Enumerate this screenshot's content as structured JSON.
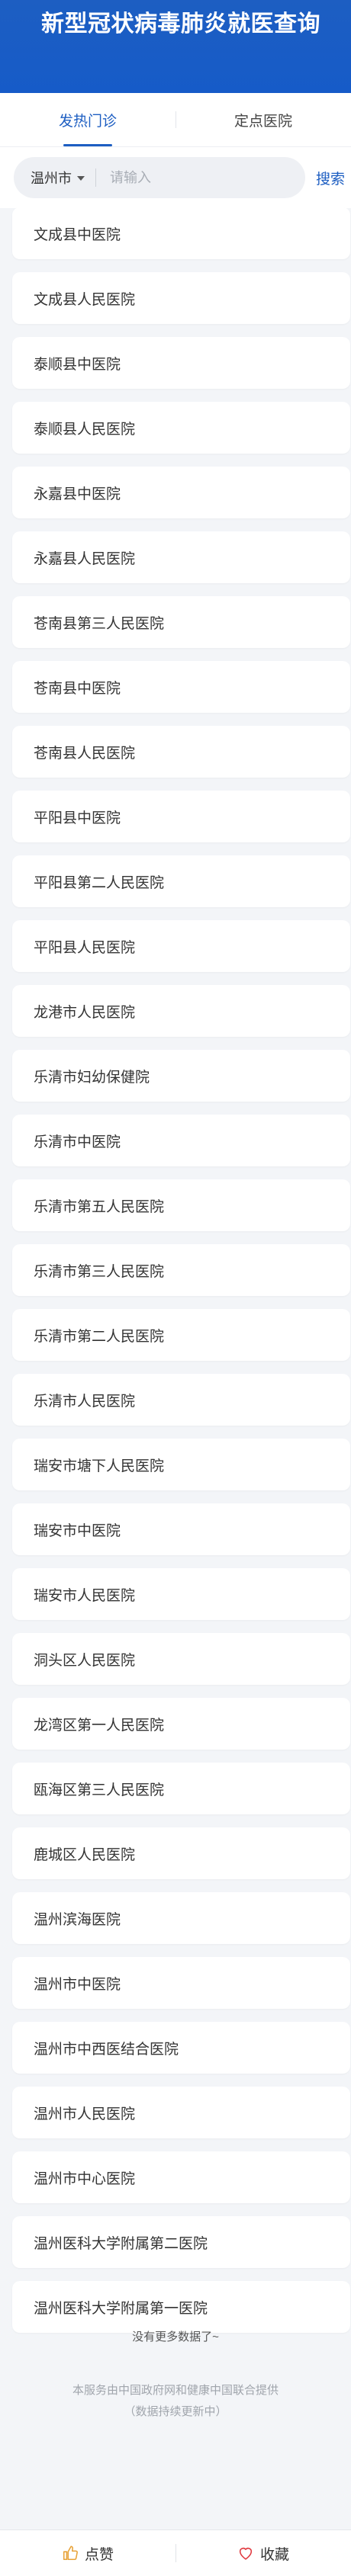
{
  "header": {
    "title": "新型冠状病毒肺炎就医查询"
  },
  "tabs": [
    {
      "label": "发热门诊",
      "active": true
    },
    {
      "label": "定点医院",
      "active": false
    }
  ],
  "search": {
    "city": "温州市",
    "placeholder": "请输入",
    "value": "",
    "button_label": "搜索"
  },
  "hospitals": [
    "文成县中医院",
    "文成县人民医院",
    "泰顺县中医院",
    "泰顺县人民医院",
    "永嘉县中医院",
    "永嘉县人民医院",
    "苍南县第三人民医院",
    "苍南县中医院",
    "苍南县人民医院",
    "平阳县中医院",
    "平阳县第二人民医院",
    "平阳县人民医院",
    "龙港市人民医院",
    "乐清市妇幼保健院",
    "乐清市中医院",
    "乐清市第五人民医院",
    "乐清市第三人民医院",
    "乐清市第二人民医院",
    "乐清市人民医院",
    "瑞安市塘下人民医院",
    "瑞安市中医院",
    "瑞安市人民医院",
    "洞头区人民医院",
    "龙湾区第一人民医院",
    "瓯海区第三人民医院",
    "鹿城区人民医院",
    "温州滨海医院",
    "温州市中医院",
    "温州市中西医结合医院",
    "温州市人民医院",
    "温州市中心医院",
    "温州医科大学附属第二医院",
    "温州医科大学附属第一医院"
  ],
  "no_more_text": "没有更多数据了~",
  "footer": {
    "line1": "本服务由中国政府网和健康中国联合提供",
    "line2": "（数据持续更新中）"
  },
  "bottom_bar": {
    "like_label": "点赞",
    "favorite_label": "收藏"
  },
  "colors": {
    "brand": "#1d5ec2",
    "background": "#f3f5f8",
    "like_icon": "#e8a33a",
    "favorite_icon": "#e0383e"
  },
  "icons": {
    "city_dropdown": "caret-down-icon",
    "like": "thumbs-up-icon",
    "favorite": "heart-icon"
  }
}
